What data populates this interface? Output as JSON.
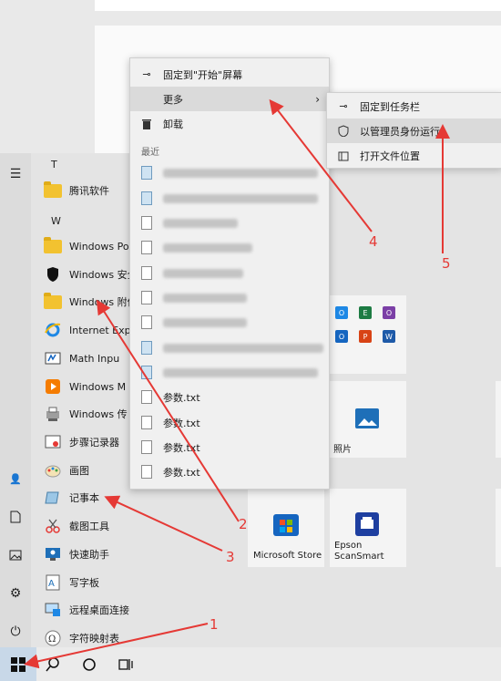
{
  "start_menu": {
    "groups": [
      {
        "letter": "T",
        "apps": [
          {
            "label": "腾讯软件",
            "icon": "folder-icon"
          }
        ]
      },
      {
        "letter": "W",
        "apps": [
          {
            "label": "Windows Pow",
            "icon": "folder-icon"
          },
          {
            "label": "Windows 安全",
            "icon": "shield-icon"
          },
          {
            "label": "Windows 附件",
            "icon": "folder-icon"
          },
          {
            "label": "Internet Exp",
            "icon": "ie-icon"
          },
          {
            "label": "Math Inpu",
            "icon": "math-input-icon"
          },
          {
            "label": "Windows M",
            "icon": "media-player-icon"
          },
          {
            "label": "Windows 传",
            "icon": "fax-scan-icon"
          },
          {
            "label": "步骤记录器",
            "icon": "steps-recorder-icon"
          },
          {
            "label": "画图",
            "icon": "paint-icon"
          },
          {
            "label": "记事本",
            "icon": "notepad-icon"
          },
          {
            "label": "截图工具",
            "icon": "snipping-tool-icon"
          },
          {
            "label": "快速助手",
            "icon": "quick-assist-icon"
          },
          {
            "label": "写字板",
            "icon": "wordpad-icon"
          },
          {
            "label": "远程桌面连接",
            "icon": "remote-desktop-icon"
          },
          {
            "label": "字符映射表",
            "icon": "character-map-icon"
          }
        ]
      }
    ],
    "rail_icons": [
      "hamburger-icon",
      "user-icon",
      "document-icon",
      "pictures-icon",
      "settings-icon",
      "power-icon"
    ]
  },
  "tiles": {
    "photos": {
      "label": "照片"
    },
    "store": {
      "label": "Microsoft Store"
    },
    "epson": {
      "label": "Epson ScanSmart"
    },
    "office_apps": [
      "OneDrive",
      "Excel",
      "OneNote",
      "Outlook",
      "PowerPoint",
      "Word"
    ]
  },
  "context_menu": {
    "pin_start": "固定到\"开始\"屏幕",
    "more": "更多",
    "uninstall": "卸载",
    "recent_header": "最近",
    "recent_files": [
      "参数.txt",
      "参数.txt",
      "参数.txt",
      "参数.txt"
    ]
  },
  "submenu": {
    "pin_taskbar": "固定到任务栏",
    "run_as_admin": "以管理员身份运行",
    "open_location": "打开文件位置"
  },
  "annotations": [
    "1",
    "2",
    "3",
    "4",
    "5"
  ],
  "colors": {
    "annotation": "#e53935",
    "accent": "#0078d4"
  }
}
